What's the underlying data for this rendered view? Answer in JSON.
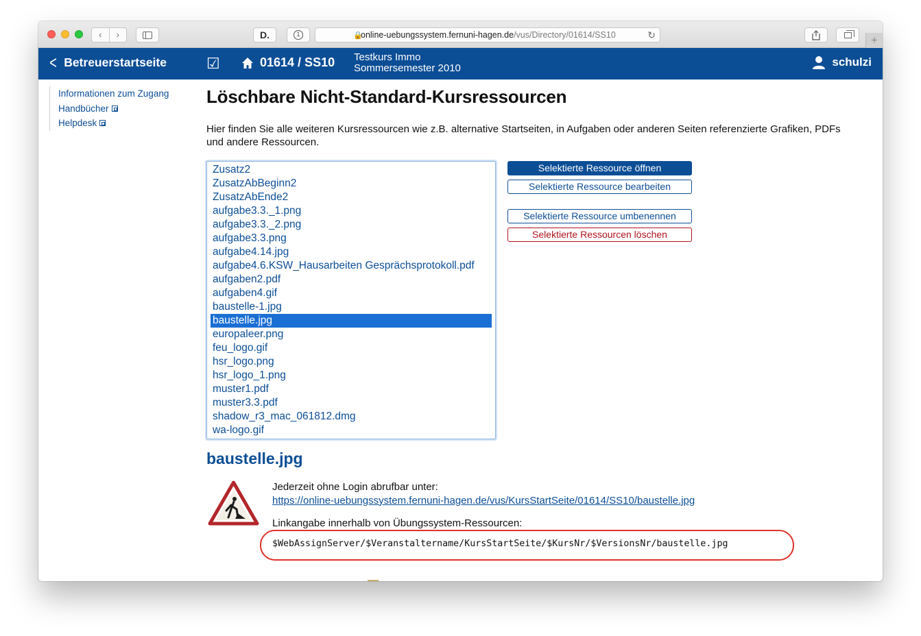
{
  "browser": {
    "url_host": "online-uebungssystem.fernuni-hagen.de",
    "url_path": "/vus/Directory/01614/SS10",
    "ext1_label": "D.",
    "ext2_label": "1"
  },
  "header": {
    "back_label": "Betreuerstartseite",
    "course_id": "01614 / SS10",
    "course_name": "Testkurs Immo",
    "course_term": "Sommersemester 2010",
    "user_name": "schulzi"
  },
  "sidebar": {
    "items": [
      {
        "label": "Informationen zum Zugang",
        "external": false
      },
      {
        "label": "Handbücher",
        "external": true
      },
      {
        "label": "Helpdesk",
        "external": true
      }
    ]
  },
  "main": {
    "title": "Löschbare Nicht-Standard-Kursressourcen",
    "intro": "Hier finden Sie alle weiteren Kursressourcen wie z.B. alternative Startseiten, in Aufgaben oder anderen Seiten referenzierte Grafiken, PDFs und andere Ressourcen.",
    "resources": [
      "Zusatz2",
      "ZusatzAbBeginn2",
      "ZusatzAbEnde2",
      "aufgabe3.3._1.png",
      "aufgabe3.3._2.png",
      "aufgabe3.3.png",
      "aufgabe4.14.jpg",
      "aufgabe4.6.KSW_Hausarbeiten Gesprächsprotokoll.pdf",
      "aufgaben2.pdf",
      "aufgaben4.gif",
      "baustelle-1.jpg",
      "baustelle.jpg",
      "europaleer.png",
      "feu_logo.gif",
      "hsr_logo.png",
      "hsr_logo_1.png",
      "muster1.pdf",
      "muster3.3.pdf",
      "shadow_r3_mac_061812.dmg",
      "wa-logo.gif"
    ],
    "selected_resource": "baustelle.jpg",
    "buttons": {
      "open": "Selektierte Ressource öffnen",
      "edit": "Selektierte Ressource bearbeiten",
      "rename": "Selektierte Ressource umbenennen",
      "delete": "Selektierte Ressourcen löschen"
    },
    "detail": {
      "title": "baustelle.jpg",
      "public_label": "Jederzeit ohne Login abrufbar unter:",
      "public_url": "https://online-uebungssystem.fernuni-hagen.de/vus/KursStartSeite/01614/SS10/baustelle.jpg",
      "link_label": "Linkangabe innerhalb von Übungssystem-Ressourcen:",
      "link_code": "$WebAssignServer/$Veranstaltername/KursStartSeite/$KursNr/$VersionsNr/baustelle.jpg"
    }
  },
  "colors": {
    "brand_blue": "#0c4e96",
    "selection_blue": "#1a6fd4",
    "danger_red": "#b0121b",
    "highlight_red": "#e0322b"
  }
}
